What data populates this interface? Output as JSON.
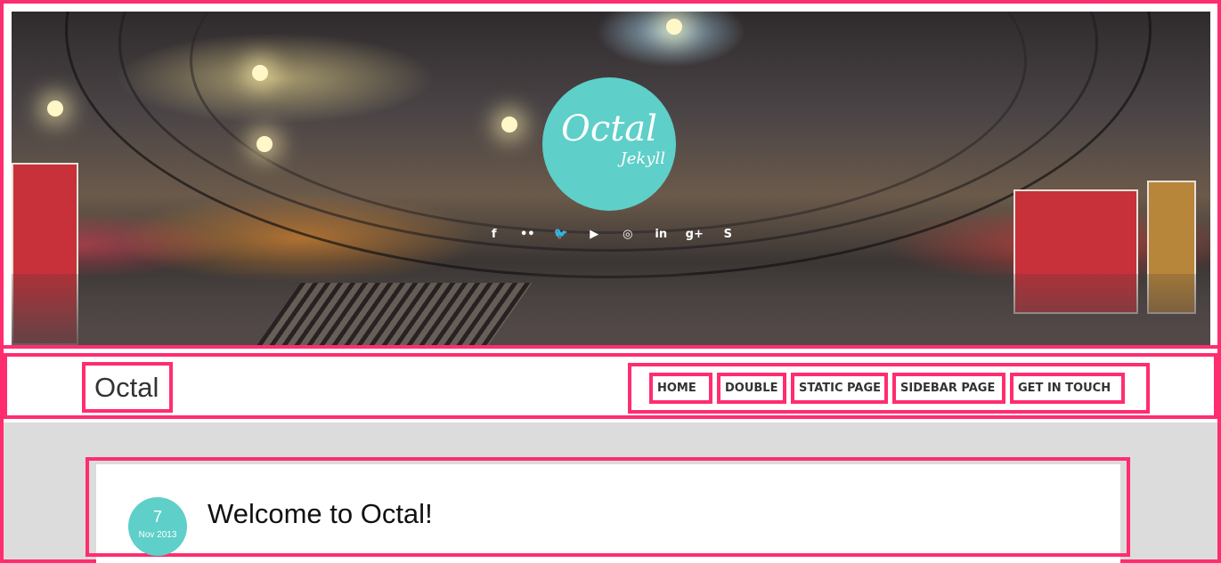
{
  "hero": {
    "logo_title": "Octal",
    "logo_subtitle": "Jekyll",
    "social_icons": [
      {
        "name": "facebook-icon",
        "glyph": "f"
      },
      {
        "name": "flickr-icon",
        "glyph": "••"
      },
      {
        "name": "twitter-icon",
        "glyph": "🐦"
      },
      {
        "name": "youtube-icon",
        "glyph": "▶"
      },
      {
        "name": "instagram-icon",
        "glyph": "◎"
      },
      {
        "name": "linkedin-icon",
        "glyph": "in"
      },
      {
        "name": "google-plus-icon",
        "glyph": "g+"
      },
      {
        "name": "skype-icon",
        "glyph": "S"
      }
    ]
  },
  "navbar": {
    "site_title": "Octal",
    "items": [
      {
        "label": "HOME"
      },
      {
        "label": "DOUBLE"
      },
      {
        "label": "STATIC PAGE"
      },
      {
        "label": "SIDEBAR PAGE"
      },
      {
        "label": "GET IN TOUCH"
      }
    ]
  },
  "post": {
    "date_day": "7",
    "date_month": "Nov 2013",
    "title": "Welcome to Octal!"
  },
  "colors": {
    "accent": "#5ecfc9",
    "highlight": "#ff2d6f",
    "content_bg": "#dcdcdc"
  }
}
